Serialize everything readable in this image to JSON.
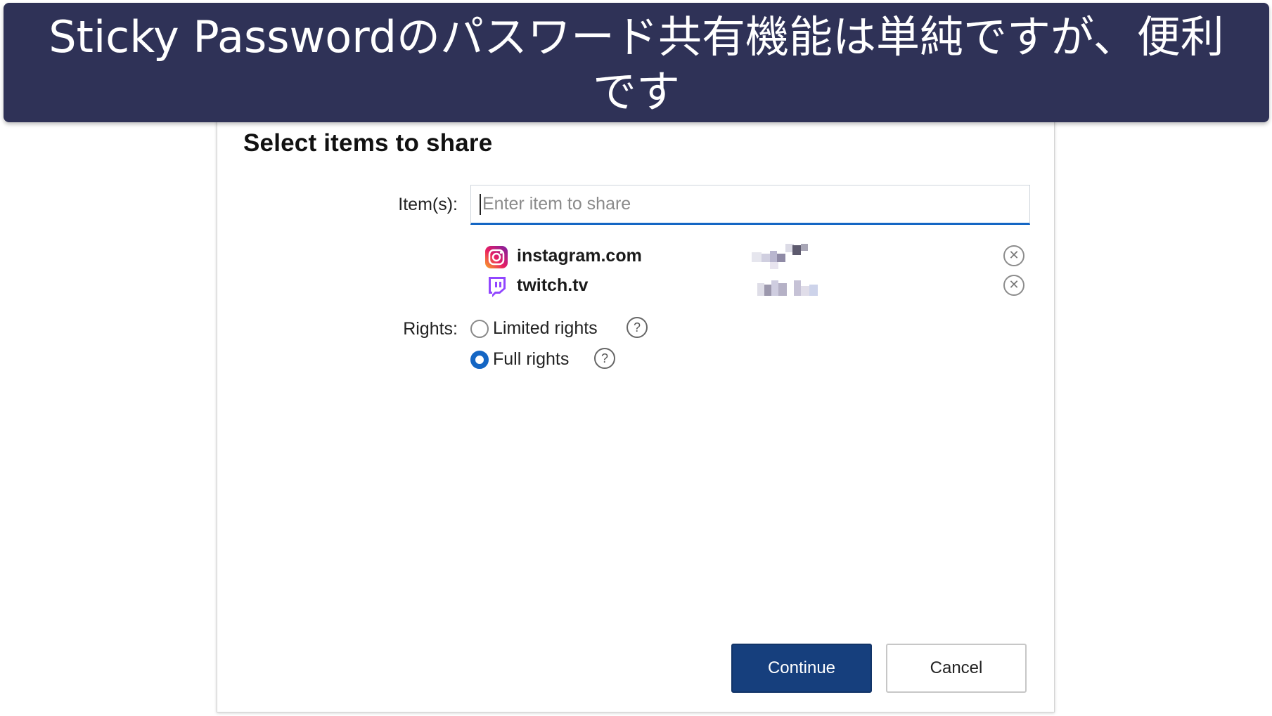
{
  "banner": {
    "text": "Sticky Passwordのパスワード共有機能は単純ですが、便利です"
  },
  "dialog": {
    "title": "Select items to share",
    "items_label": "Item(s):",
    "items_placeholder": "Enter item to share",
    "shared_items": [
      {
        "name": "instagram.com",
        "icon": "instagram-icon",
        "remove_icon": "remove-icon"
      },
      {
        "name": "twitch.tv",
        "icon": "twitch-icon",
        "remove_icon": "remove-icon"
      }
    ],
    "rights_label": "Rights:",
    "rights_options": [
      {
        "label": "Limited rights",
        "checked": false,
        "help": "?"
      },
      {
        "label": "Full rights",
        "checked": true,
        "help": "?"
      }
    ],
    "continue_label": "Continue",
    "cancel_label": "Cancel"
  },
  "colors": {
    "banner_bg": "#2f3257",
    "primary_button": "#163f7d",
    "accent_blue": "#1466c4"
  }
}
